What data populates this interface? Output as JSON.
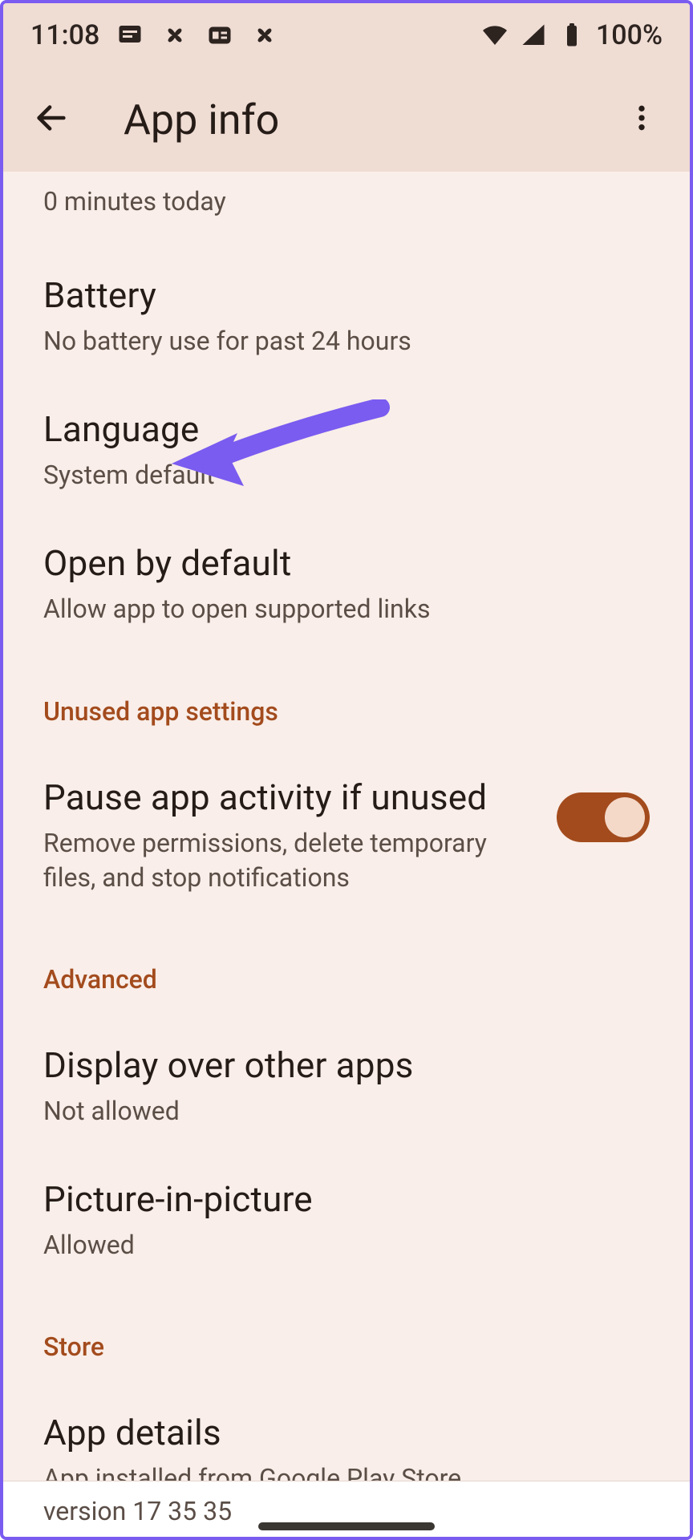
{
  "status": {
    "time": "11:08",
    "battery_pct": "100%"
  },
  "appbar": {
    "title": "App info"
  },
  "partial_item_sub": "0 minutes today",
  "items": {
    "battery": {
      "title": "Battery",
      "sub": "No battery use for past 24 hours"
    },
    "language": {
      "title": "Language",
      "sub": "System default"
    },
    "open_by_default": {
      "title": "Open by default",
      "sub": "Allow app to open supported links"
    }
  },
  "section_unused": {
    "header": "Unused app settings"
  },
  "pause_app": {
    "title": "Pause app activity if unused",
    "sub": "Remove permissions, delete temporary files, and stop notifications",
    "toggle_on": true
  },
  "section_advanced": {
    "header": "Advanced"
  },
  "display_over": {
    "title": "Display over other apps",
    "sub": "Not allowed"
  },
  "pip": {
    "title": "Picture-in-picture",
    "sub": "Allowed"
  },
  "section_store": {
    "header": "Store"
  },
  "app_details": {
    "title": "App details",
    "sub": "App installed from Google Play Store"
  },
  "version_cutoff": "version 17 35 35",
  "colors": {
    "accent": "#a34b1d",
    "appbar_bg": "#efdcd3",
    "page_bg": "#f9eee9",
    "arrow": "#7a5cf0"
  }
}
